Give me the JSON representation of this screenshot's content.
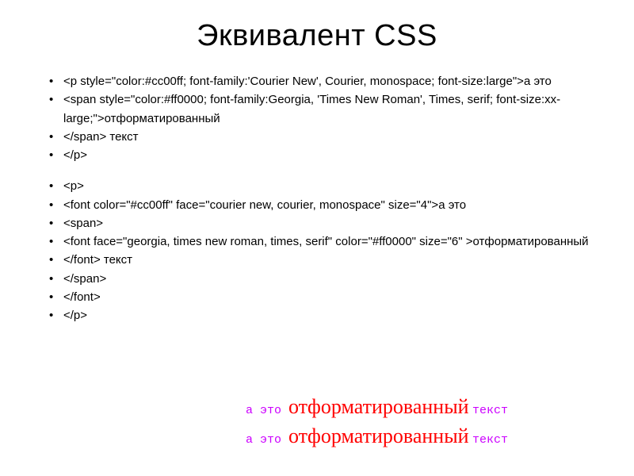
{
  "title": "Эквивалент CSS",
  "bullets": {
    "b1": "<p style=\"color:#cc00ff; font-family:'Courier New', Courier, monospace;  font-size:large\">а это",
    "b2": "  <span style=\"color:#ff0000; font-family:Georgia, 'Times New Roman', Times, serif; font-size:xx-large;\">отформатированный",
    "b3": "   </span> текст",
    "b4": "</p>",
    "b5": "<p>",
    "b6": "  <font color=\"#cc00ff\"  face=\"courier new, courier, monospace\" size=\"4\">а это",
    "b7": "   <span>",
    "b8": "    <font face=\"georgia, times new roman, times, serif\" color=\"#ff0000\" size=\"6\" >отформатированный",
    "b9": "     </font> текст",
    "b10": "   </span>",
    "b11": "  </font>",
    "b12": " </p>"
  },
  "render": {
    "line1": {
      "a": "а это ",
      "b": "отформатированный",
      "c": " текст"
    },
    "line2": {
      "a": "а это ",
      "b": "отформатированный",
      "c": " текст"
    }
  }
}
